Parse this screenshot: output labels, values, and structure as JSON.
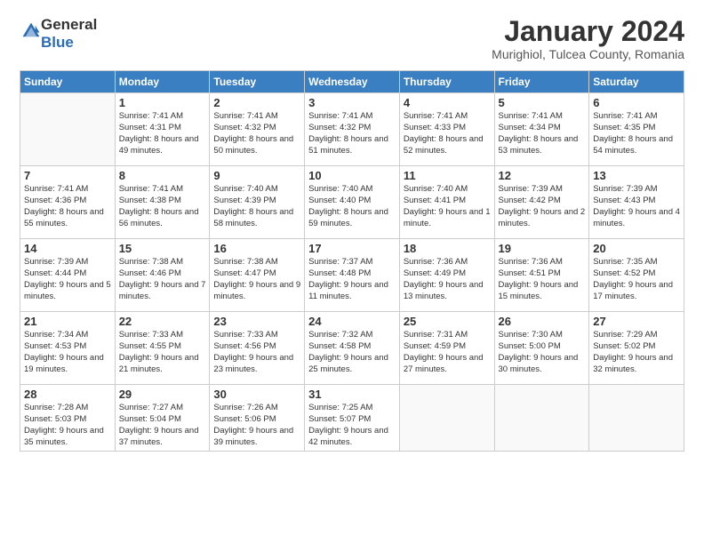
{
  "header": {
    "logo_line1": "General",
    "logo_line2": "Blue",
    "month_year": "January 2024",
    "location": "Murighiol, Tulcea County, Romania"
  },
  "weekdays": [
    "Sunday",
    "Monday",
    "Tuesday",
    "Wednesday",
    "Thursday",
    "Friday",
    "Saturday"
  ],
  "weeks": [
    [
      {
        "day": "",
        "sunrise": "",
        "sunset": "",
        "daylight": ""
      },
      {
        "day": "1",
        "sunrise": "Sunrise: 7:41 AM",
        "sunset": "Sunset: 4:31 PM",
        "daylight": "Daylight: 8 hours and 49 minutes."
      },
      {
        "day": "2",
        "sunrise": "Sunrise: 7:41 AM",
        "sunset": "Sunset: 4:32 PM",
        "daylight": "Daylight: 8 hours and 50 minutes."
      },
      {
        "day": "3",
        "sunrise": "Sunrise: 7:41 AM",
        "sunset": "Sunset: 4:32 PM",
        "daylight": "Daylight: 8 hours and 51 minutes."
      },
      {
        "day": "4",
        "sunrise": "Sunrise: 7:41 AM",
        "sunset": "Sunset: 4:33 PM",
        "daylight": "Daylight: 8 hours and 52 minutes."
      },
      {
        "day": "5",
        "sunrise": "Sunrise: 7:41 AM",
        "sunset": "Sunset: 4:34 PM",
        "daylight": "Daylight: 8 hours and 53 minutes."
      },
      {
        "day": "6",
        "sunrise": "Sunrise: 7:41 AM",
        "sunset": "Sunset: 4:35 PM",
        "daylight": "Daylight: 8 hours and 54 minutes."
      }
    ],
    [
      {
        "day": "7",
        "sunrise": "Sunrise: 7:41 AM",
        "sunset": "Sunset: 4:36 PM",
        "daylight": "Daylight: 8 hours and 55 minutes."
      },
      {
        "day": "8",
        "sunrise": "Sunrise: 7:41 AM",
        "sunset": "Sunset: 4:38 PM",
        "daylight": "Daylight: 8 hours and 56 minutes."
      },
      {
        "day": "9",
        "sunrise": "Sunrise: 7:40 AM",
        "sunset": "Sunset: 4:39 PM",
        "daylight": "Daylight: 8 hours and 58 minutes."
      },
      {
        "day": "10",
        "sunrise": "Sunrise: 7:40 AM",
        "sunset": "Sunset: 4:40 PM",
        "daylight": "Daylight: 8 hours and 59 minutes."
      },
      {
        "day": "11",
        "sunrise": "Sunrise: 7:40 AM",
        "sunset": "Sunset: 4:41 PM",
        "daylight": "Daylight: 9 hours and 1 minute."
      },
      {
        "day": "12",
        "sunrise": "Sunrise: 7:39 AM",
        "sunset": "Sunset: 4:42 PM",
        "daylight": "Daylight: 9 hours and 2 minutes."
      },
      {
        "day": "13",
        "sunrise": "Sunrise: 7:39 AM",
        "sunset": "Sunset: 4:43 PM",
        "daylight": "Daylight: 9 hours and 4 minutes."
      }
    ],
    [
      {
        "day": "14",
        "sunrise": "Sunrise: 7:39 AM",
        "sunset": "Sunset: 4:44 PM",
        "daylight": "Daylight: 9 hours and 5 minutes."
      },
      {
        "day": "15",
        "sunrise": "Sunrise: 7:38 AM",
        "sunset": "Sunset: 4:46 PM",
        "daylight": "Daylight: 9 hours and 7 minutes."
      },
      {
        "day": "16",
        "sunrise": "Sunrise: 7:38 AM",
        "sunset": "Sunset: 4:47 PM",
        "daylight": "Daylight: 9 hours and 9 minutes."
      },
      {
        "day": "17",
        "sunrise": "Sunrise: 7:37 AM",
        "sunset": "Sunset: 4:48 PM",
        "daylight": "Daylight: 9 hours and 11 minutes."
      },
      {
        "day": "18",
        "sunrise": "Sunrise: 7:36 AM",
        "sunset": "Sunset: 4:49 PM",
        "daylight": "Daylight: 9 hours and 13 minutes."
      },
      {
        "day": "19",
        "sunrise": "Sunrise: 7:36 AM",
        "sunset": "Sunset: 4:51 PM",
        "daylight": "Daylight: 9 hours and 15 minutes."
      },
      {
        "day": "20",
        "sunrise": "Sunrise: 7:35 AM",
        "sunset": "Sunset: 4:52 PM",
        "daylight": "Daylight: 9 hours and 17 minutes."
      }
    ],
    [
      {
        "day": "21",
        "sunrise": "Sunrise: 7:34 AM",
        "sunset": "Sunset: 4:53 PM",
        "daylight": "Daylight: 9 hours and 19 minutes."
      },
      {
        "day": "22",
        "sunrise": "Sunrise: 7:33 AM",
        "sunset": "Sunset: 4:55 PM",
        "daylight": "Daylight: 9 hours and 21 minutes."
      },
      {
        "day": "23",
        "sunrise": "Sunrise: 7:33 AM",
        "sunset": "Sunset: 4:56 PM",
        "daylight": "Daylight: 9 hours and 23 minutes."
      },
      {
        "day": "24",
        "sunrise": "Sunrise: 7:32 AM",
        "sunset": "Sunset: 4:58 PM",
        "daylight": "Daylight: 9 hours and 25 minutes."
      },
      {
        "day": "25",
        "sunrise": "Sunrise: 7:31 AM",
        "sunset": "Sunset: 4:59 PM",
        "daylight": "Daylight: 9 hours and 27 minutes."
      },
      {
        "day": "26",
        "sunrise": "Sunrise: 7:30 AM",
        "sunset": "Sunset: 5:00 PM",
        "daylight": "Daylight: 9 hours and 30 minutes."
      },
      {
        "day": "27",
        "sunrise": "Sunrise: 7:29 AM",
        "sunset": "Sunset: 5:02 PM",
        "daylight": "Daylight: 9 hours and 32 minutes."
      }
    ],
    [
      {
        "day": "28",
        "sunrise": "Sunrise: 7:28 AM",
        "sunset": "Sunset: 5:03 PM",
        "daylight": "Daylight: 9 hours and 35 minutes."
      },
      {
        "day": "29",
        "sunrise": "Sunrise: 7:27 AM",
        "sunset": "Sunset: 5:04 PM",
        "daylight": "Daylight: 9 hours and 37 minutes."
      },
      {
        "day": "30",
        "sunrise": "Sunrise: 7:26 AM",
        "sunset": "Sunset: 5:06 PM",
        "daylight": "Daylight: 9 hours and 39 minutes."
      },
      {
        "day": "31",
        "sunrise": "Sunrise: 7:25 AM",
        "sunset": "Sunset: 5:07 PM",
        "daylight": "Daylight: 9 hours and 42 minutes."
      },
      {
        "day": "",
        "sunrise": "",
        "sunset": "",
        "daylight": ""
      },
      {
        "day": "",
        "sunrise": "",
        "sunset": "",
        "daylight": ""
      },
      {
        "day": "",
        "sunrise": "",
        "sunset": "",
        "daylight": ""
      }
    ]
  ]
}
